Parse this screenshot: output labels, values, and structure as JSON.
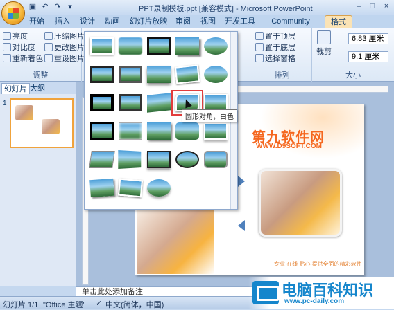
{
  "window": {
    "title": "PPT录制模板.ppt [兼容模式] - Microsoft PowerPoint"
  },
  "tabs": [
    {
      "label": "开始"
    },
    {
      "label": "插入"
    },
    {
      "label": "设计"
    },
    {
      "label": "动画"
    },
    {
      "label": "幻灯片放映"
    },
    {
      "label": "审阅"
    },
    {
      "label": "视图"
    },
    {
      "label": "开发工具"
    },
    {
      "label": "Community Clips"
    },
    {
      "label": "格式"
    }
  ],
  "ribbon": {
    "adjust": {
      "brightness": "亮度",
      "contrast": "对比度",
      "recolor": "重新着色",
      "compress": "压缩图片",
      "change": "更改图片",
      "reset": "重设图片",
      "group_label": "调整"
    },
    "arrange": {
      "bring_front": "置于顶层",
      "send_back": "置于底层",
      "selection_pane": "选择窗格",
      "group_label": "排列"
    },
    "size": {
      "crop": "裁剪",
      "height": "6.83 厘米",
      "width": "9.1 厘米",
      "group_label": "大小"
    }
  },
  "left_panel": {
    "tab_slides": "幻灯片",
    "tab_outline": "大纲",
    "slide_number": "1"
  },
  "slide": {
    "watermark_main": "第九软件网",
    "watermark_url": "WWW.D9SOFT.COM",
    "caption": "专业 在线 贴心 提供全面的精彩软件"
  },
  "gallery": {
    "tooltip": "圆形对角，白色",
    "styles": [
      {
        "name": "简单框架，白色"
      },
      {
        "name": "柔化边缘矩形"
      },
      {
        "name": "双框架，黑色"
      },
      {
        "name": "透视阴影，白色"
      },
      {
        "name": "映像圆角矩形"
      },
      {
        "name": "中等复杂框架，黑色"
      },
      {
        "name": "金属框架"
      },
      {
        "name": "居中矩形阴影"
      },
      {
        "name": "旋转，白色"
      },
      {
        "name": "柔化边缘椭圆"
      },
      {
        "name": "复杂框架，黑色"
      },
      {
        "name": "厚重亚光，黑色"
      },
      {
        "name": "映像右透视"
      },
      {
        "name": "圆形对角，白色"
      },
      {
        "name": "剪裁对角，白色"
      },
      {
        "name": "简单框架，黑色"
      },
      {
        "name": "棱台亚光，白色"
      },
      {
        "name": "矩形投影"
      },
      {
        "name": "圆角矩形"
      },
      {
        "name": "映像棱台，白色"
      },
      {
        "name": "斜面矩形"
      },
      {
        "name": "棱台透视"
      },
      {
        "name": "映像棱台，黑色"
      },
      {
        "name": "棱台形椭圆，黑色"
      },
      {
        "name": "金属圆角矩形"
      },
      {
        "name": "透视阴影，黑色"
      },
      {
        "name": "旋转，白色2"
      },
      {
        "name": "映像椭圆"
      }
    ]
  },
  "notes": {
    "placeholder": "单击此处添加备注"
  },
  "status": {
    "slide_info": "幻灯片 1/1",
    "theme": "\"Office 主题\"",
    "language": "中文(简体，中国)"
  },
  "brand": {
    "name": "电脑百科知识",
    "url": "www.pc-daily.com"
  },
  "colors": {
    "accent": "#1586cc",
    "tab_active": "#fbe3b5",
    "highlight": "#e23c3c",
    "watermark": "#f5671e"
  }
}
